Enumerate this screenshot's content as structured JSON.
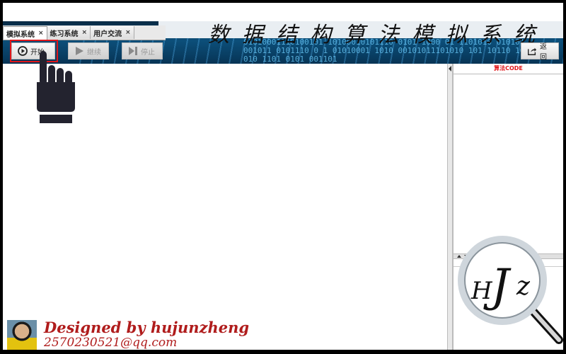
{
  "tabs": [
    {
      "label": "模拟系统",
      "close": "×"
    },
    {
      "label": "练习系统",
      "close": "×"
    },
    {
      "label": "用户交流",
      "close": "×"
    }
  ],
  "banner": {
    "title": "数据结构算法模拟系统",
    "digits": "01010001110100101 10100010101110 0101 1000 01 1101010 010101 001011 0101110 0 1 01010001 1010 00101011101010 101 10110 10 010 1101 0101 001101"
  },
  "toolbar": {
    "start_label": "开始",
    "continue_label": "继续",
    "stop_label": "停止",
    "back_label": "返回"
  },
  "right_panel": {
    "title": "算法CODE"
  },
  "footer": {
    "designed_by": "Designed by  hujunzheng",
    "contact": "2570230521@qq.com"
  },
  "logo": {
    "text": "HJZ"
  },
  "colors": {
    "accent_red": "#e0161a",
    "signature": "#b01c1c",
    "banner_blue": "#0c4f7a"
  }
}
